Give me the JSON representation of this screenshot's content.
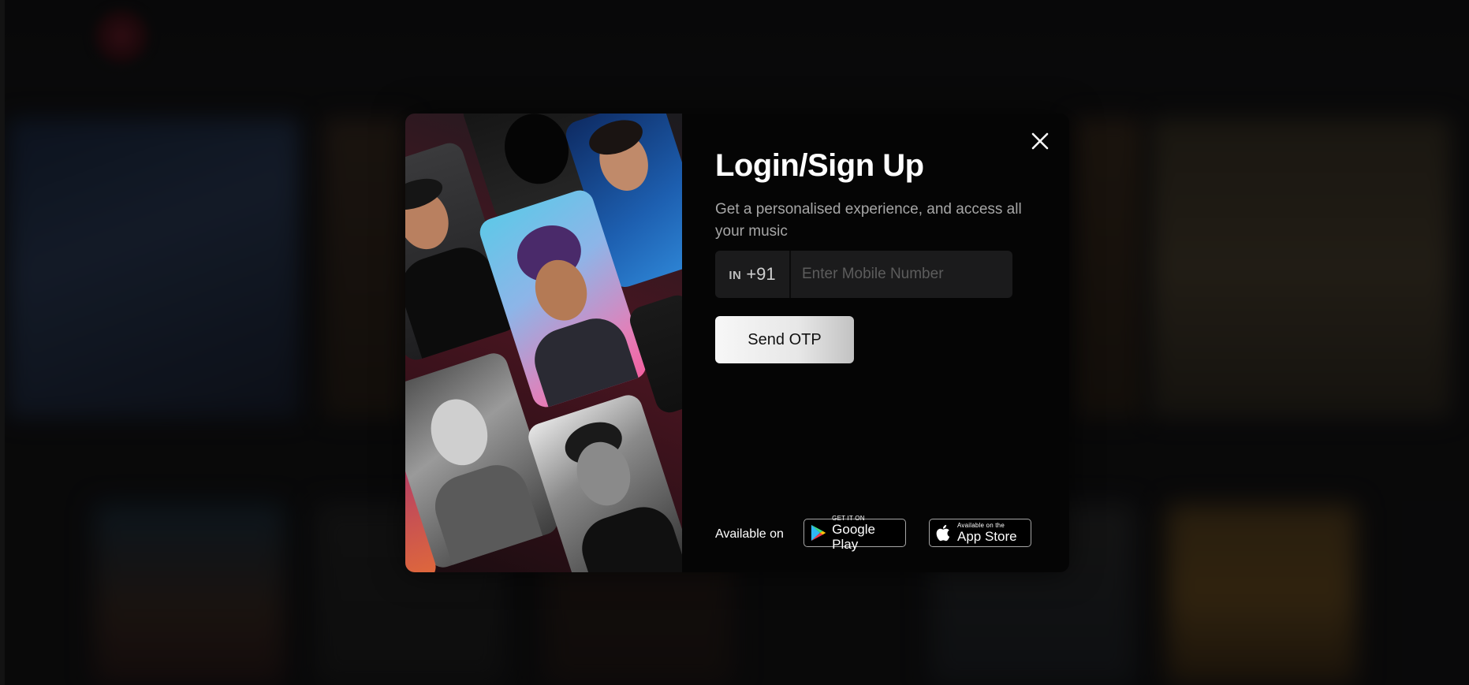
{
  "modal": {
    "title": "Login/Sign Up",
    "subtitle": "Get a personalised experience, and access all your music",
    "country_code": "IN",
    "dial_code": "+91",
    "phone_placeholder": "Enter Mobile Number",
    "phone_value": "",
    "send_otp_label": "Send OTP",
    "available_label": "Available on",
    "google_play": {
      "small": "GET IT ON",
      "big": "Google Play"
    },
    "app_store": {
      "small": "Available on the",
      "big": "App Store"
    }
  },
  "icons": {
    "close": "close-icon",
    "google_play": "google-play-icon",
    "apple": "apple-icon"
  }
}
